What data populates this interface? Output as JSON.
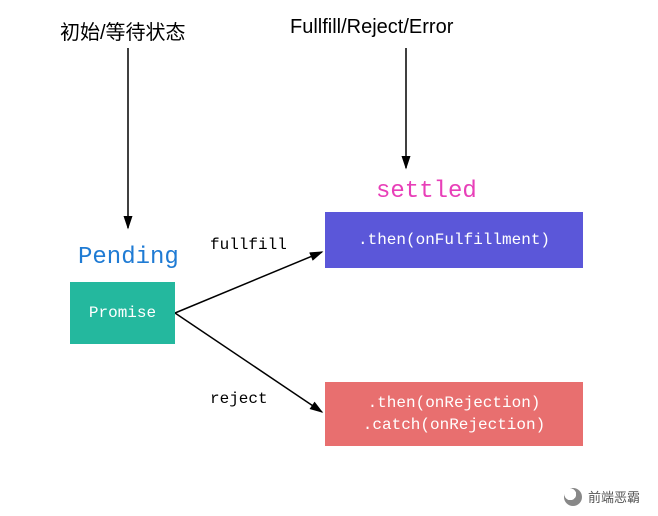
{
  "labels": {
    "top_left": "初始/等待状态",
    "top_right": "Fullfill/Reject/Error"
  },
  "states": {
    "pending": "Pending",
    "settled": "settled"
  },
  "boxes": {
    "promise": "Promise",
    "then_fulfill": ".then(onFulfillment)",
    "then_reject_line1": ".then(onRejection)",
    "then_reject_line2": ".catch(onRejection)"
  },
  "edges": {
    "fullfill": "fullfill",
    "reject": "reject"
  },
  "watermark": "前端恶霸",
  "colors": {
    "pending": "#1f7bd4",
    "settled": "#e83fb8",
    "promise_box": "#24b89e",
    "then_box": "#5b57d9",
    "catch_box": "#e86f6f"
  },
  "chart_data": {
    "type": "diagram",
    "title": "Promise state transitions",
    "nodes": [
      {
        "id": "init_label",
        "text": "初始/等待状态",
        "kind": "annotation"
      },
      {
        "id": "result_label",
        "text": "Fullfill/Reject/Error",
        "kind": "annotation"
      },
      {
        "id": "pending",
        "text": "Pending",
        "kind": "state-label"
      },
      {
        "id": "settled",
        "text": "settled",
        "kind": "state-label"
      },
      {
        "id": "promise",
        "text": "Promise",
        "kind": "box",
        "color": "#24b89e"
      },
      {
        "id": "then_fulfill",
        "text": ".then(onFulfillment)",
        "kind": "box",
        "color": "#5b57d9"
      },
      {
        "id": "then_reject",
        "text": ".then(onRejection)\n.catch(onRejection)",
        "kind": "box",
        "color": "#e86f6f"
      }
    ],
    "edges": [
      {
        "from": "init_label",
        "to": "pending",
        "label": ""
      },
      {
        "from": "result_label",
        "to": "settled",
        "label": ""
      },
      {
        "from": "promise",
        "to": "then_fulfill",
        "label": "fullfill"
      },
      {
        "from": "promise",
        "to": "then_reject",
        "label": "reject"
      }
    ]
  }
}
